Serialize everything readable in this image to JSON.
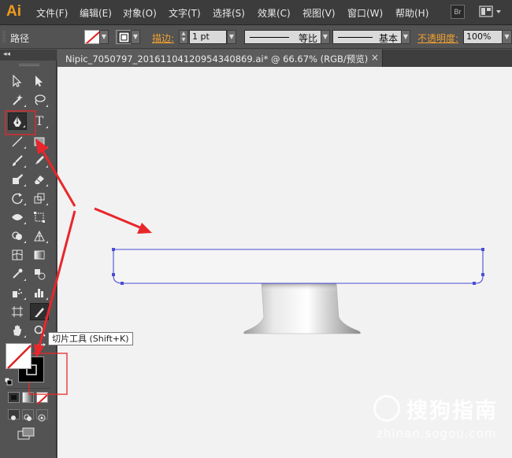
{
  "app": {
    "logo": "Ai"
  },
  "menu": {
    "items": [
      "文件(F)",
      "编辑(E)",
      "对象(O)",
      "文字(T)",
      "选择(S)",
      "效果(C)",
      "视图(V)",
      "窗口(W)",
      "帮助(H)"
    ],
    "bridge_label": "Br"
  },
  "control_bar": {
    "object_label": "路径",
    "stroke_link": "描边:",
    "stroke_weight": "1 pt",
    "stroke_style_1": "等比",
    "stroke_style_2": "基本",
    "opacity_link": "不透明度:",
    "opacity_value": "100%"
  },
  "document": {
    "tab_title": "Nipic_7050797_20161104120954340869.ai* @ 66.67% (RGB/预览)",
    "close_glyph": "×"
  },
  "toolbox": {
    "type_tool_glyph": "T",
    "tooltip": "切片工具 (Shift+K)"
  },
  "watermark": {
    "title": "搜狗指南",
    "url": "zhinan.sogou.com"
  },
  "colors": {
    "accent_orange": "#f29b1c",
    "link_orange": "#f0a030",
    "path_blue": "#4a4ed4",
    "annotation_red": "#e8262b"
  },
  "icons": [
    "selection-icon",
    "direct-selection-icon",
    "magic-wand-icon",
    "lasso-icon",
    "pen-icon",
    "type-icon",
    "line-icon",
    "rectangle-icon",
    "paintbrush-icon",
    "pencil-icon",
    "blob-brush-icon",
    "eraser-icon",
    "rotate-icon",
    "scale-icon",
    "width-icon",
    "free-transform-icon",
    "shape-builder-icon",
    "perspective-grid-icon",
    "mesh-icon",
    "gradient-icon",
    "eyedropper-icon",
    "blend-icon",
    "symbol-sprayer-icon",
    "column-graph-icon",
    "artboard-icon",
    "slice-icon",
    "hand-icon",
    "zoom-icon",
    "fill-swatch-icon",
    "stroke-swatch-icon",
    "swap-icon",
    "default-colors-icon",
    "color-mode-icon",
    "gradient-mode-icon",
    "none-mode-icon",
    "draw-normal-icon",
    "draw-behind-icon",
    "draw-inside-icon",
    "screen-mode-icon"
  ]
}
